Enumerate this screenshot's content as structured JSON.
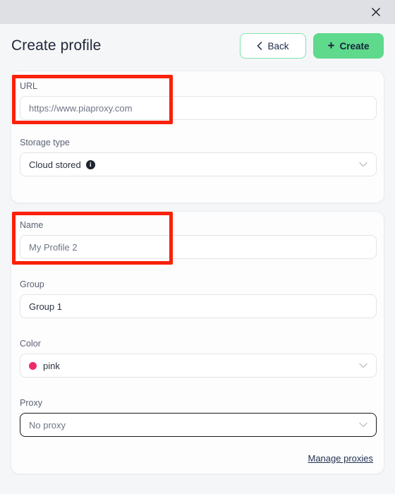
{
  "titlebar": {
    "close_label": "close-icon"
  },
  "header": {
    "title": "Create profile",
    "back_label": "Back",
    "create_label": "Create",
    "create_plus": "+"
  },
  "cards": {
    "top": {
      "fields": [
        {
          "label": "URL",
          "value": "https://www.piaproxy.com",
          "placeholder": "https://www.piaproxy.com",
          "type": "text"
        },
        {
          "label": "Storage type",
          "value": "Cloud stored",
          "type": "select",
          "has_info_icon": true,
          "info_glyph": "i"
        }
      ]
    },
    "bottom": {
      "fields": [
        {
          "label": "Name",
          "value": "My Profile 2",
          "placeholder": "My Profile 2",
          "type": "text"
        },
        {
          "label": "Group",
          "value": "Group 1",
          "type": "text"
        },
        {
          "label": "Color",
          "value": "pink",
          "type": "select",
          "swatch": "#ef2a6a"
        },
        {
          "label": "Proxy",
          "value": "No proxy",
          "type": "select",
          "focused": true
        }
      ],
      "manage_link": "Manage proxies"
    }
  },
  "colors": {
    "accent_green": "#5fd98c",
    "accent_green_border": "#7fe3a8",
    "annotation_red": "#fa2109",
    "titlebar": "#dfe0e4",
    "page_background": "#f5f6f8",
    "card_background": "#fdfdfe",
    "pink_swatch": "#ef2a6a",
    "link_navy": "#23314f"
  }
}
